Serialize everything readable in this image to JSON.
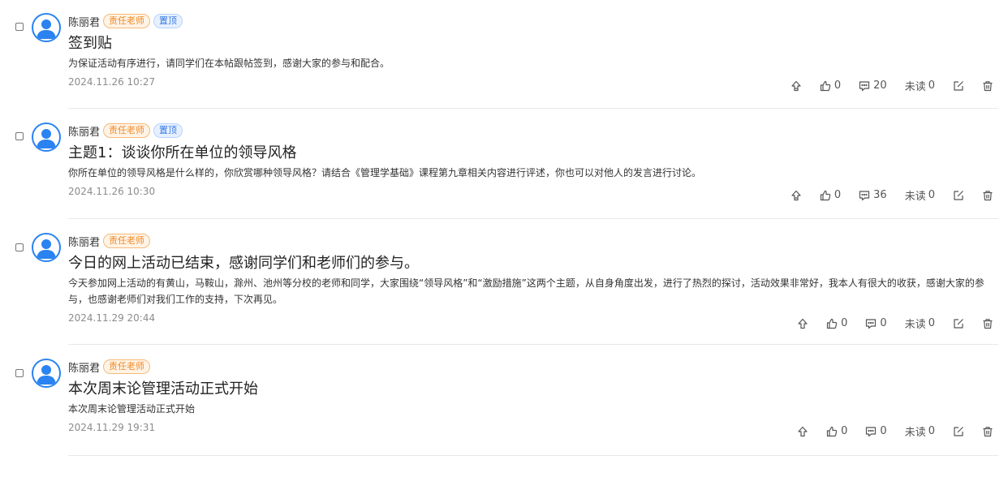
{
  "posts": [
    {
      "author": "陈丽君",
      "tags": [
        "责任老师",
        "置顶"
      ],
      "title": "签到贴",
      "description": "为保证活动有序进行，请同学们在本帖跟帖签到，感谢大家的参与和配合。",
      "date": "2024.11.26 10:27",
      "likes": "0",
      "comments": "20",
      "unread_label": "未读",
      "unread_count": "0"
    },
    {
      "author": "陈丽君",
      "tags": [
        "责任老师",
        "置顶"
      ],
      "title": "主题1：谈谈你所在单位的领导风格",
      "description": "你所在单位的领导风格是什么样的，你欣赏哪种领导风格？请结合《管理学基础》课程第九章相关内容进行评述，你也可以对他人的发言进行讨论。",
      "date": "2024.11.26 10:30",
      "likes": "0",
      "comments": "36",
      "unread_label": "未读",
      "unread_count": "0"
    },
    {
      "author": "陈丽君",
      "tags": [
        "责任老师"
      ],
      "title": "今日的网上活动已结束，感谢同学们和老师们的参与。",
      "description": "今天参加网上活动的有黄山，马鞍山，滁州、池州等分校的老师和同学，大家围绕“领导风格”和“激励措施”这两个主题，从自身角度出发，进行了热烈的探讨，活动效果非常好，我本人有很大的收获，感谢大家的参与，也感谢老师们对我们工作的支持，下次再见。",
      "date": "2024.11.29 20:44",
      "likes": "0",
      "comments": "0",
      "unread_label": "未读",
      "unread_count": "0"
    },
    {
      "author": "陈丽君",
      "tags": [
        "责任老师"
      ],
      "title": "本次周末论管理活动正式开始",
      "description": "本次周末论管理活动正式开始",
      "date": "2024.11.29 19:31",
      "likes": "0",
      "comments": "0",
      "unread_label": "未读",
      "unread_count": "0"
    }
  ],
  "icons": {
    "checkbox": "checkbox-icon",
    "avatar": "user-avatar-icon",
    "pin": "pin-top-icon",
    "like": "thumbs-up-icon",
    "comment": "comment-icon",
    "edit": "edit-icon",
    "delete": "trash-icon"
  },
  "colors": {
    "accent": "#2a83f0",
    "teacher_tag": "#f08a24",
    "top_tag": "#3a7be0",
    "divider": "#e8e8e8",
    "date": "#8c8c8c"
  }
}
